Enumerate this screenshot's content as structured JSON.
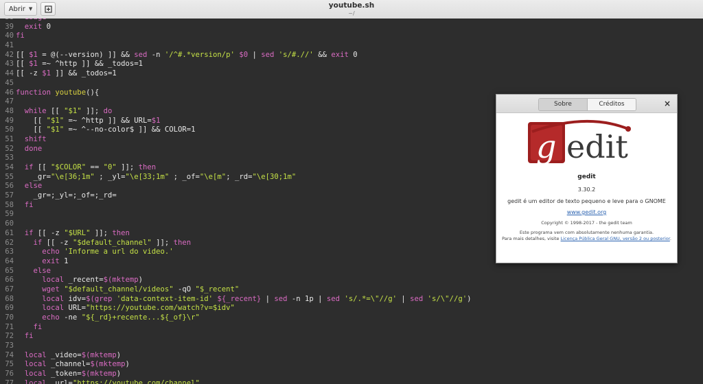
{
  "header": {
    "open_label": "Abrir",
    "title": "youtube.sh",
    "subtitle": "~/"
  },
  "editor": {
    "lines": [
      {
        "n": "38",
        "t": "  usage"
      },
      {
        "n": "39",
        "t": "  exit 0"
      },
      {
        "n": "40",
        "t": "fi"
      },
      {
        "n": "41",
        "t": ""
      },
      {
        "n": "42",
        "t": "[[ $1 = @(--version) ]] && sed -n '/^#.*version/p' $0 | sed 's/#.//' && exit 0"
      },
      {
        "n": "43",
        "t": "[[ $1 =~ ^http ]] && _todos=1"
      },
      {
        "n": "44",
        "t": "[[ -z $1 ]] && _todos=1"
      },
      {
        "n": "45",
        "t": ""
      },
      {
        "n": "46",
        "t": "function youtube(){"
      },
      {
        "n": "47",
        "t": ""
      },
      {
        "n": "48",
        "t": "  while [[ \"$1\" ]]; do"
      },
      {
        "n": "49",
        "t": "    [[ \"$1\" =~ ^http ]] && URL=$1"
      },
      {
        "n": "50",
        "t": "    [[ \"$1\" =~ ^--no-color$ ]] && COLOR=1"
      },
      {
        "n": "51",
        "t": "  shift"
      },
      {
        "n": "52",
        "t": "  done"
      },
      {
        "n": "53",
        "t": ""
      },
      {
        "n": "54",
        "t": "  if [[ \"$COLOR\" == \"0\" ]]; then"
      },
      {
        "n": "55",
        "t": "    _gr=\"\\e[36;1m\" ; _yl=\"\\e[33;1m\" ; _of=\"\\e[m\"; _rd=\"\\e[30;1m\""
      },
      {
        "n": "56",
        "t": "  else"
      },
      {
        "n": "57",
        "t": "    _gr=;_yl=;_of=;_rd="
      },
      {
        "n": "58",
        "t": "  fi"
      },
      {
        "n": "59",
        "t": ""
      },
      {
        "n": "60",
        "t": ""
      },
      {
        "n": "61",
        "t": "  if [[ -z \"$URL\" ]]; then"
      },
      {
        "n": "62",
        "t": "    if [[ -z \"$default_channel\" ]]; then"
      },
      {
        "n": "63",
        "t": "      echo 'Informe a url do video.'"
      },
      {
        "n": "64",
        "t": "      exit 1"
      },
      {
        "n": "65",
        "t": "    else"
      },
      {
        "n": "66",
        "t": "      local _recent=$(mktemp)"
      },
      {
        "n": "67",
        "t": "      wget \"$default_channel/videos\" -qO \"$_recent\""
      },
      {
        "n": "68",
        "t": "      local idv=$(grep 'data-context-item-id' ${_recent} | sed -n 1p | sed 's/.*=\\\"//g' | sed 's/\\\"//g')"
      },
      {
        "n": "69",
        "t": "      local URL=\"https://youtube.com/watch?v=$idv\""
      },
      {
        "n": "70",
        "t": "      echo -ne \"${_rd}+recente...${_of}\\r\""
      },
      {
        "n": "71",
        "t": "    fi"
      },
      {
        "n": "72",
        "t": "  fi"
      },
      {
        "n": "73",
        "t": ""
      },
      {
        "n": "74",
        "t": "  local _video=$(mktemp)"
      },
      {
        "n": "75",
        "t": "  local _channel=$(mktemp)"
      },
      {
        "n": "76",
        "t": "  local _token=$(mktemp)"
      },
      {
        "n": "77",
        "t": "  local _url=\"https://youtube.com/channel\""
      }
    ]
  },
  "about": {
    "tab_about": "Sobre",
    "tab_credits": "Créditos",
    "close": "×",
    "logo_text": "gedit",
    "name": "gedit",
    "version": "3.30.2",
    "description": "gedit é um editor de texto pequeno e leve para o GNOME",
    "website": "www.gedit.org",
    "copyright": "Copyright © 1998-2017 - the gedit team",
    "license_line1": "Este programa vem com absolutamente nenhuma garantia.",
    "license_line2_prefix": "Para mais detalhes, visite ",
    "license_link": "Licença Pública Geral GNU, versão 2 ou posterior",
    "license_line2_suffix": "."
  }
}
